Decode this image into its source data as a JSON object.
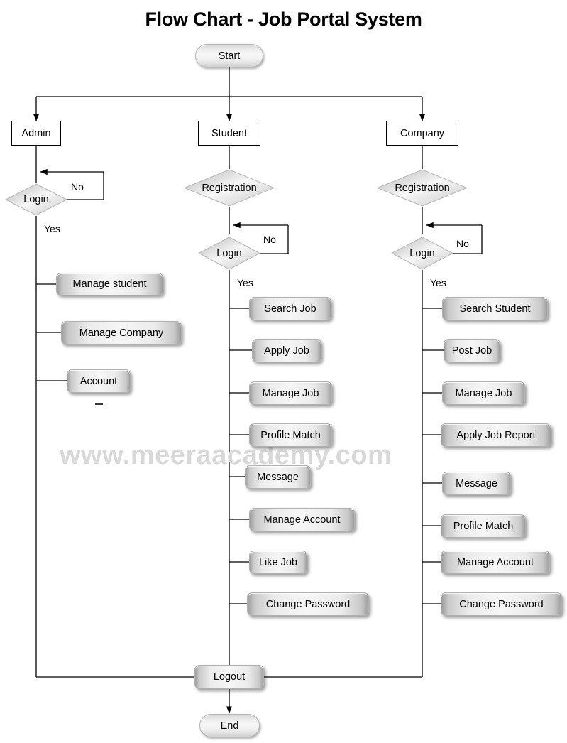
{
  "title": "Flow Chart - Job Portal System",
  "watermark": "www.meeraacademy.com",
  "colors": {
    "line": "#000000",
    "node_fill_light": "#f6f6f6",
    "node_fill_dark": "#9e9e9e",
    "border": "#b0b0b0",
    "text": "#000000",
    "watermark": "#d8d8d8"
  },
  "diagram": {
    "type": "flowchart",
    "start": {
      "label": "Start",
      "shape": "terminator"
    },
    "end": {
      "label": "End",
      "shape": "terminator"
    },
    "logout": {
      "label": "Logout",
      "shape": "process"
    },
    "actors": [
      {
        "label": "Admin",
        "shape": "rectangle"
      },
      {
        "label": "Student",
        "shape": "rectangle"
      },
      {
        "label": "Company",
        "shape": "rectangle"
      }
    ],
    "decisions": {
      "admin_login": {
        "label": "Login",
        "shape": "diamond"
      },
      "student_registration": {
        "label": "Registration",
        "shape": "diamond"
      },
      "student_login": {
        "label": "Login",
        "shape": "diamond"
      },
      "company_registration": {
        "label": "Registration",
        "shape": "diamond"
      },
      "company_login": {
        "label": "Login",
        "shape": "diamond"
      }
    },
    "edge_labels": {
      "admin_no": "No",
      "admin_yes": "Yes",
      "student_no": "No",
      "student_yes": "Yes",
      "company_no": "No",
      "company_yes": "Yes"
    },
    "branches": [
      {
        "actor": "Admin",
        "tasks": [
          "Manage student",
          "Manage Company",
          "Account"
        ]
      },
      {
        "actor": "Student",
        "tasks": [
          "Search Job",
          "Apply Job",
          "Manage Job",
          "Profile Match",
          "Message",
          "Manage Account",
          "Like Job",
          "Change Password"
        ]
      },
      {
        "actor": "Company",
        "tasks": [
          "Search Student",
          "Post Job",
          "Manage Job",
          "Apply Job Report",
          "Message",
          "Profile Match",
          "Manage Account",
          "Change Password"
        ]
      }
    ]
  }
}
